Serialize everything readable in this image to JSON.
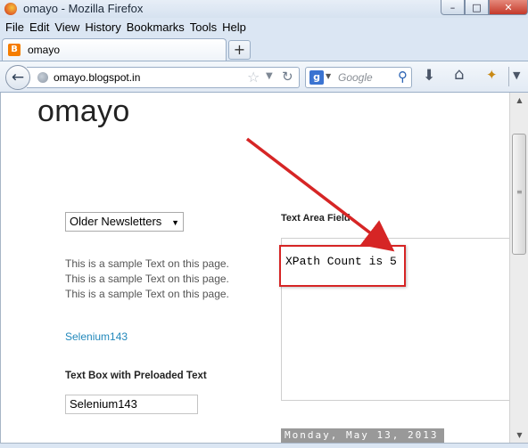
{
  "window": {
    "title": "omayo - Mozilla Firefox",
    "controls": [
      "–",
      "□",
      "✕"
    ]
  },
  "menu": [
    "File",
    "Edit",
    "View",
    "History",
    "Bookmarks",
    "Tools",
    "Help"
  ],
  "tab": {
    "title": "omayo",
    "icon_letter": "B",
    "close": "✕"
  },
  "newtab": "+",
  "nav": {
    "url": "omayo.blogspot.in",
    "search_placeholder": "Google",
    "search_engine_letter": "g"
  },
  "page": {
    "site_title": "omayo",
    "newsletter_select": "Older Newsletters",
    "sample_lines": [
      "This is a sample Text on this page.",
      "This is a sample Text on this page.",
      "This is a sample Text on this page."
    ],
    "link": "Selenium143",
    "textbox_label": "Text Box with Preloaded Text",
    "textbox_value": "Selenium143",
    "textarea_label": "Text Area Field",
    "xpath_text": "XPath Count is 5",
    "date_bar": "Monday, May 13, 2013"
  },
  "colors": {
    "accent_red": "#d62525",
    "link_blue": "#2288bb"
  },
  "icons": [
    "firefox-logo-icon",
    "blogger-icon",
    "back-arrow-icon",
    "globe-icon",
    "star-icon",
    "reload-icon",
    "google-icon",
    "search-icon",
    "download-icon",
    "home-icon",
    "addon-icon"
  ]
}
